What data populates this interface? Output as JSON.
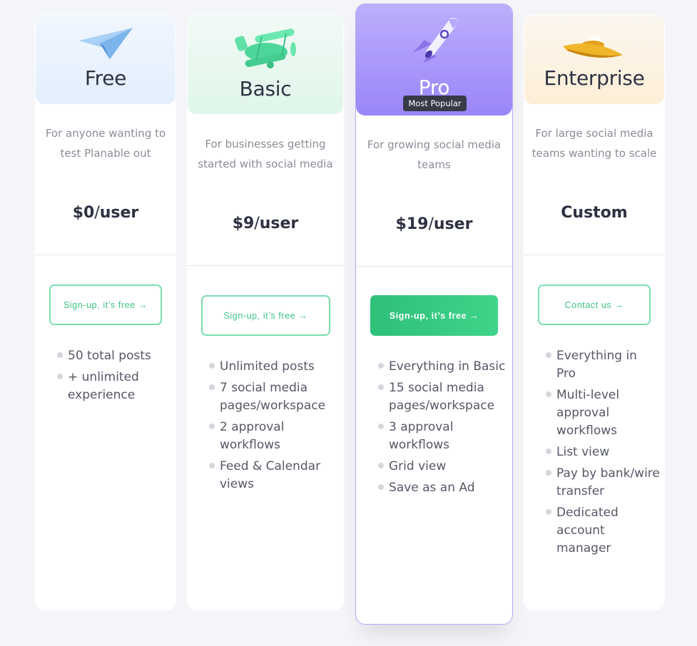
{
  "plans": [
    {
      "id": "free",
      "name": "Free",
      "illustration": "paper-plane-icon",
      "description": "For anyone wanting to test Planable out",
      "price": {
        "amount": "$0",
        "separator": "/",
        "unit": "user"
      },
      "cta": "Sign-up, it’s free →",
      "features": [
        "50 total posts",
        "+ unlimited experience"
      ]
    },
    {
      "id": "basic",
      "name": "Basic",
      "illustration": "biplane-icon",
      "description": "For businesses getting started with social media",
      "price": {
        "amount": "$9",
        "separator": "/",
        "unit": "user"
      },
      "cta": "Sign-up, it’s free →",
      "features": [
        "Unlimited posts",
        "7 social media pages/workspace",
        "2 approval workflows",
        "Feed & Calendar views"
      ]
    },
    {
      "id": "pro",
      "name": "Pro",
      "illustration": "rocket-icon",
      "badge": "Most Popular",
      "description": "For growing social media teams",
      "price": {
        "amount": "$19",
        "separator": "/",
        "unit": "user"
      },
      "cta": "Sign-up, it’s free →",
      "features": [
        "Everything in Basic",
        "15 social media pages/workspace",
        "3 approval workflows",
        "Grid view",
        "Save as an Ad"
      ]
    },
    {
      "id": "enterprise",
      "name": "Enterprise",
      "illustration": "ufo-icon",
      "description": "For large social media teams wanting to scale",
      "price": {
        "amount": "Custom",
        "separator": "",
        "unit": ""
      },
      "cta": "Contact us →",
      "features": [
        "Everything in Pro",
        "Multi-level approval workflows",
        "List view",
        "Pay by bank/wire transfer",
        "Dedicated account manager"
      ]
    }
  ],
  "colors": {
    "accent_green": "#3cc482",
    "pro_purple": "#9a85f8",
    "text_dark": "#2d3142",
    "text_muted": "#8a8d98"
  }
}
